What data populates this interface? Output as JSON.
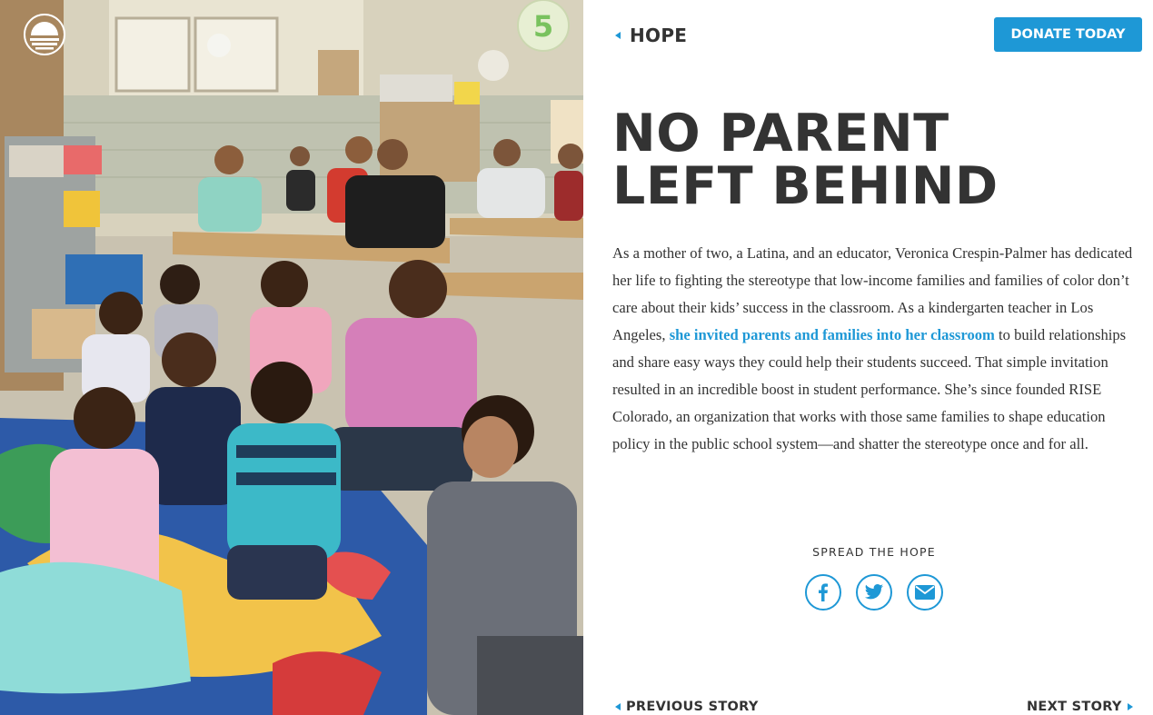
{
  "header": {
    "back_label": "HOPE",
    "donate_label": "DONATE TODAY"
  },
  "article": {
    "title_line1": "NO PARENT",
    "title_line2": "LEFT BEHIND",
    "body_before_link": "As a mother of two, a Latina, and an educator, Veronica Crespin-Palmer has dedicated her life to fighting the stereotype that low-income families and families of color don’t care about their kids’ success in the classroom. As a kindergarten teacher in Los Angeles, ",
    "body_link": "she invited parents and families into her classroom",
    "body_after_link": " to build relationships and share easy ways they could help their students succeed. That simple invitation resulted in an incredible boost in student performance. She’s since founded RISE Colorado, an organization that works with those same families to shape education policy in the public school system—and shatter the stereotype once and for all."
  },
  "share": {
    "label": "SPREAD THE HOPE",
    "icons": [
      "facebook-icon",
      "twitter-icon",
      "email-icon"
    ]
  },
  "footer_nav": {
    "previous_label": "PREVIOUS STORY",
    "next_label": "NEXT STORY"
  },
  "photo": {
    "wall_number": "5"
  },
  "colors": {
    "accent": "#1e98d6",
    "text": "#333333",
    "background": "#ffffff"
  }
}
